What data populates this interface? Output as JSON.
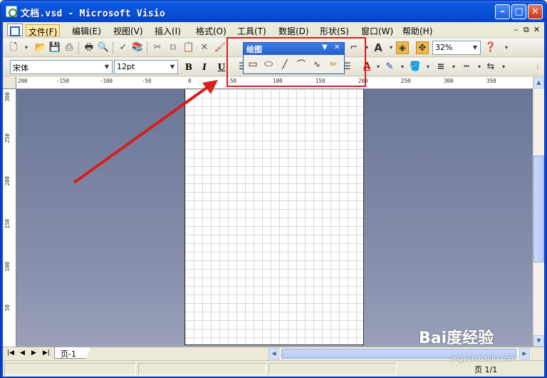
{
  "window": {
    "title": "文档.vsd - Microsoft Visio"
  },
  "menubar": {
    "items": [
      {
        "label": "文件(F)",
        "active": true
      },
      {
        "label": "编辑(E)"
      },
      {
        "label": "视图(V)"
      },
      {
        "label": "插入(I)"
      },
      {
        "label": "格式(O)"
      },
      {
        "label": "工具(T)"
      },
      {
        "label": "数据(D)"
      },
      {
        "label": "形状(S)"
      },
      {
        "label": "窗口(W)"
      },
      {
        "label": "帮助(H)"
      }
    ]
  },
  "standard_toolbar": {
    "zoom": "32%",
    "icons": [
      "new-icon",
      "open-icon",
      "save-icon",
      "permission-icon",
      "print-icon",
      "print-preview-icon",
      "spelling-icon",
      "research-icon",
      "cut-icon",
      "copy-icon",
      "paste-icon",
      "delete-icon",
      "format-painter-icon",
      "connector-icon",
      "text-tool-icon",
      "fill-shape-icon",
      "pan-zoom-icon",
      "help-icon"
    ]
  },
  "formatting_toolbar": {
    "font": "宋体",
    "size": "12pt",
    "bold": "B",
    "italic": "I",
    "underline": "U"
  },
  "drawing_toolbar": {
    "title": "绘图",
    "tools": [
      "rectangle-tool-icon",
      "ellipse-tool-icon",
      "line-tool-icon",
      "arc-tool-icon",
      "freeform-tool-icon",
      "pencil-tool-icon"
    ]
  },
  "rulers": {
    "horizontal": [
      "200",
      "-150",
      "-100",
      "-50",
      "0",
      "50",
      "100",
      "150",
      "200",
      "250",
      "300",
      "350"
    ],
    "vertical": [
      "300",
      "250",
      "200",
      "150",
      "100",
      "50"
    ]
  },
  "pagetabs": {
    "active": "页-1"
  },
  "statusbar": {
    "page": "页 1/1"
  },
  "watermark": {
    "text": "Bai度经验",
    "sub": "jingyan.baidu.com"
  },
  "colors": {
    "highlight": "#d42020",
    "arrow": "#d42020",
    "titlebar": "#0a50d6"
  }
}
